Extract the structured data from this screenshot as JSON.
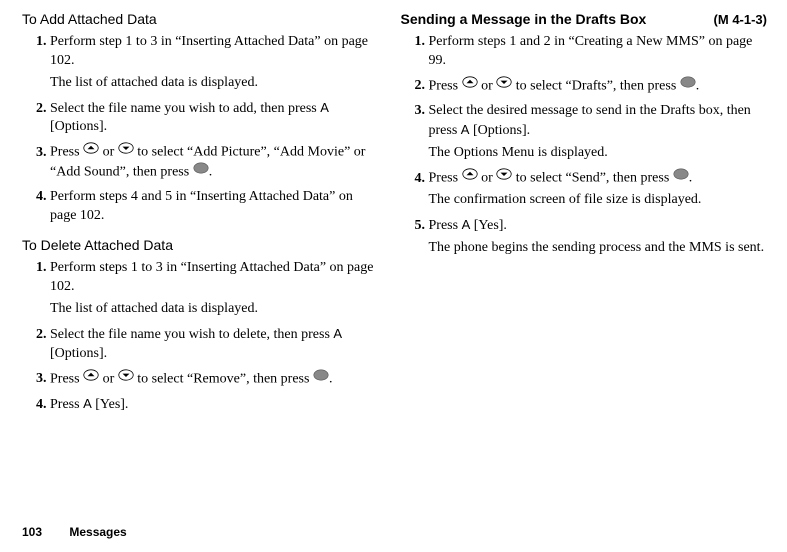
{
  "left": {
    "add": {
      "title": "To Add Attached Data",
      "s1": "Perform step 1 to 3 in “Inserting Attached Data” on page 102.",
      "s1b": "The list of attached data is displayed.",
      "s2a": "Select the file name you wish to add, then press ",
      "s2key": "A",
      "s2b": " [Options].",
      "s3a": "Press ",
      "s3or": " or ",
      "s3b": " to select “Add Picture”, “Add Movie” or “Add Sound”, then press ",
      "s3end": ".",
      "s4": "Perform steps 4 and 5 in “Inserting Attached Data” on page 102."
    },
    "del": {
      "title": "To Delete Attached Data",
      "s1": "Perform steps 1 to 3 in “Inserting Attached Data” on page 102.",
      "s1b": "The list of attached data is displayed.",
      "s2a": "Select the file name you wish to delete, then press ",
      "s2key": "A",
      "s2b": " [Options].",
      "s3a": "Press ",
      "s3or": " or ",
      "s3b": " to select “Remove”, then press ",
      "s3end": ".",
      "s4a": "Press ",
      "s4key": "A",
      "s4b": " [Yes]."
    }
  },
  "right": {
    "title": "Sending a Message in the Drafts Box",
    "code": "(M 4-1-3)",
    "s1": "Perform steps 1 and 2 in “Creating a New MMS” on page 99.",
    "s2a": "Press ",
    "s2or": " or ",
    "s2b": " to select “Drafts”, then press ",
    "s2end": ".",
    "s3a": "Select the desired message to send in the Drafts box, then press ",
    "s3key": "A",
    "s3b": " [Options].",
    "s3c": "The Options Menu is displayed.",
    "s4a": "Press ",
    "s4or": " or ",
    "s4b": " to select “Send”, then press ",
    "s4end": ".",
    "s4c": "The confirmation screen of file size is displayed.",
    "s5a": "Press ",
    "s5key": "A",
    "s5b": " [Yes].",
    "s5c": "The phone begins the sending process and the MMS is sent."
  },
  "footer": {
    "page": "103",
    "section": "Messages"
  }
}
